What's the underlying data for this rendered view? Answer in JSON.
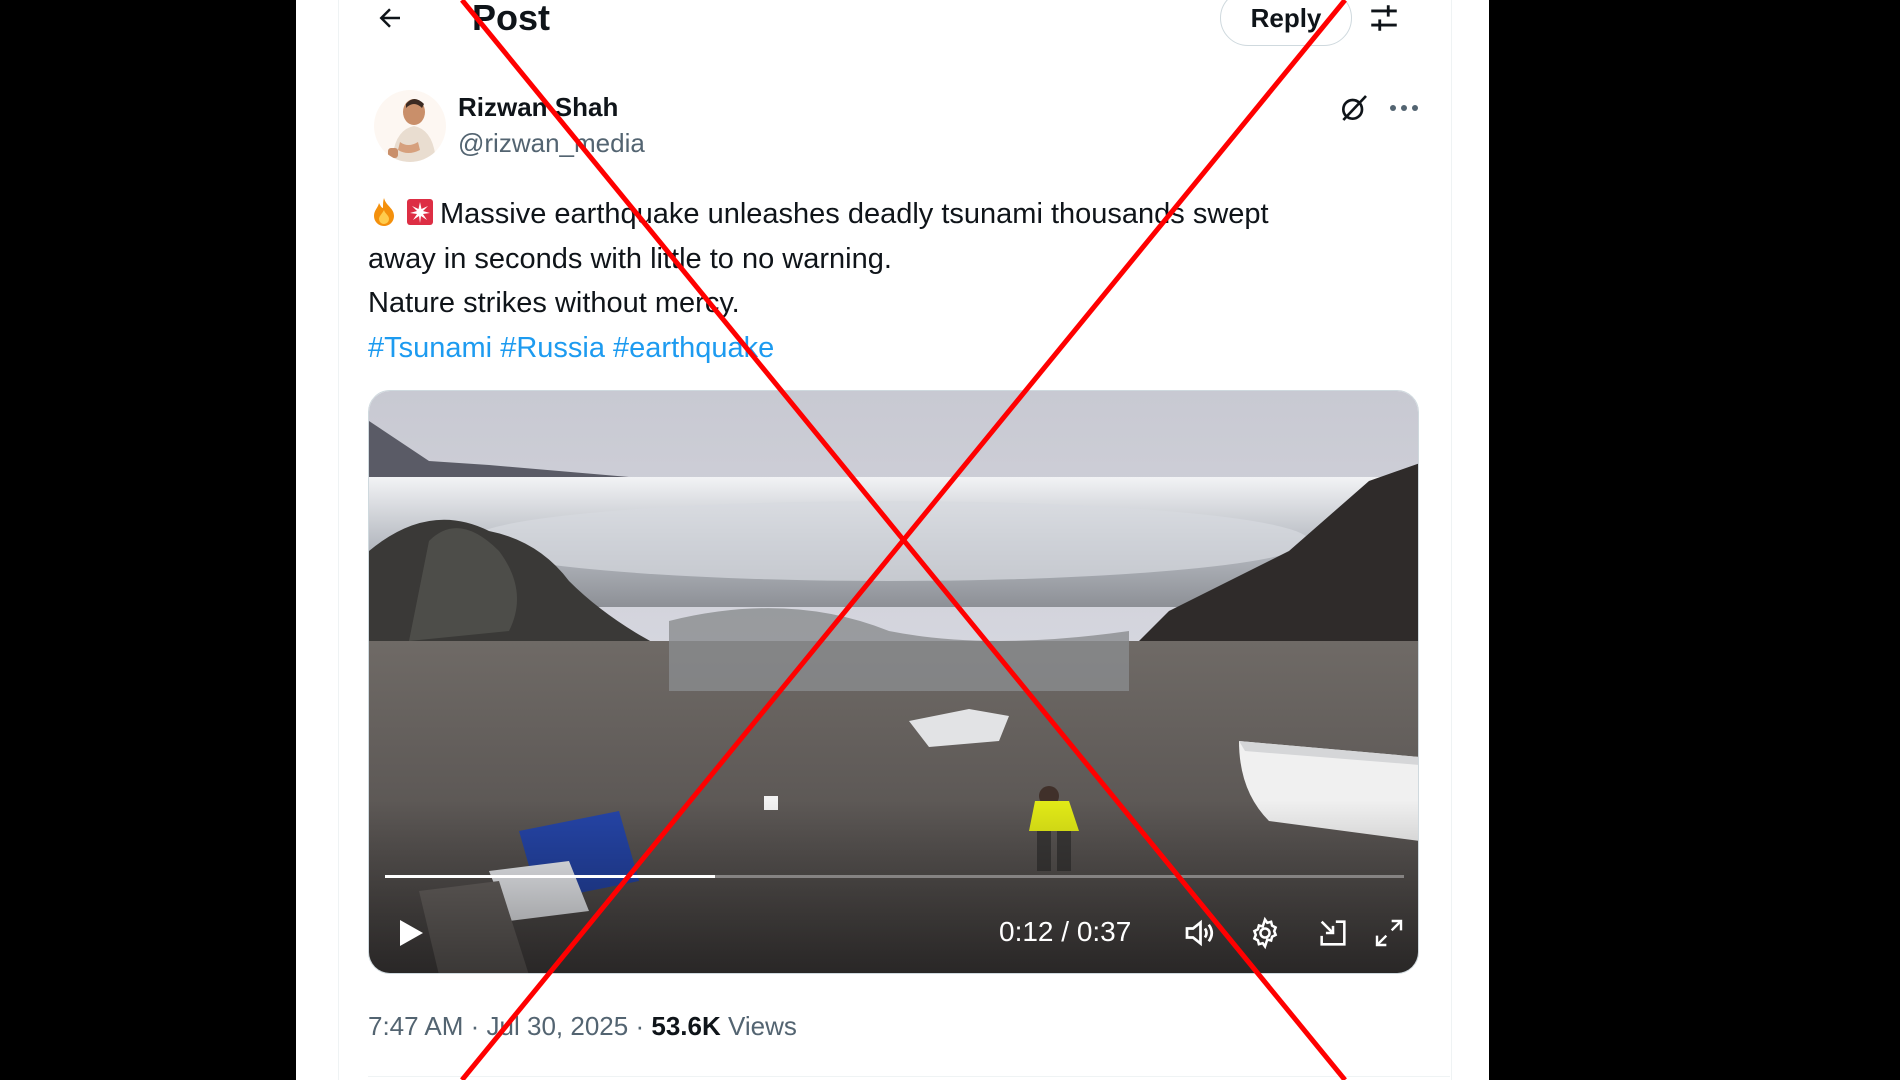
{
  "header": {
    "title": "Post",
    "reply_label": "Reply"
  },
  "icons": {
    "back": "back-arrow-icon",
    "filter": "sliders-icon",
    "grok": "grok-icon",
    "more": "more-dots-icon",
    "play": "play-icon",
    "volume": "volume-icon",
    "settings": "gear-icon",
    "pip": "picture-in-picture-icon",
    "fullscreen": "fullscreen-icon"
  },
  "author": {
    "name": "Rizwan Shah",
    "handle": "@rizwan_media"
  },
  "tweet": {
    "line1": "Massive earthquake unleashes deadly tsunami thousands swept",
    "line2": "away in seconds with little to no warning.",
    "line3": "Nature strikes without mercy.",
    "hashtags": [
      "#Tsunami",
      "#Russia",
      "#earthquake"
    ],
    "emoji": [
      "fire",
      "siren"
    ]
  },
  "video": {
    "time": "0:12 / 0:37",
    "progress_fraction": 0.324
  },
  "meta": {
    "time": "7:47 AM",
    "sep1": "·",
    "date": "Jul 30, 2025",
    "sep2": "·",
    "views_count": "53.6K",
    "views_label": "Views"
  },
  "colors": {
    "link": "#1d9bf0",
    "overlay_x": "#ff0000",
    "secondary_text": "#536471"
  }
}
